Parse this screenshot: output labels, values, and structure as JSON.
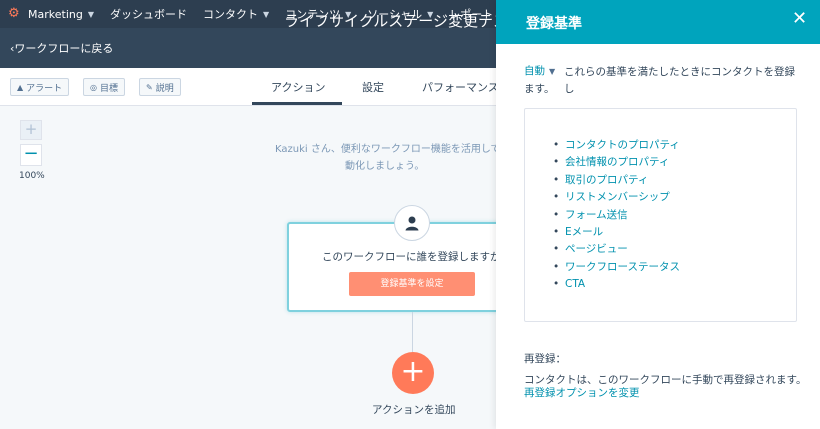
{
  "topnav": {
    "brand": "Marketing",
    "items": [
      {
        "label": "ダッシュボード"
      },
      {
        "label": "コンタクト"
      },
      {
        "label": "コンテンツ"
      },
      {
        "label": "ソーシャル"
      },
      {
        "label": "レポート"
      }
    ]
  },
  "subheader": {
    "back": "ワークフローに戻る",
    "title": "ライフサイクルステージ変更テス"
  },
  "toolbar": {
    "alert": "アラート",
    "goal": "目標",
    "description": "説明",
    "tabs": [
      "アクション",
      "設定",
      "パフォーマンス"
    ]
  },
  "canvas": {
    "zoom_level": "100%",
    "tip_line1": "Kazuki さん、便利なワークフロー機能を活用して",
    "tip_line2": "動化しましょう。",
    "trigger_question": "このワークフローに誰を登録しますか?",
    "set_criteria": "登録基準を設定",
    "add_action": "アクションを追加"
  },
  "panel": {
    "title": "登録基準",
    "auto_dropdown": "自動",
    "criteria_line1": "これらの基準を満たしたときにコンタクトを登録し",
    "criteria_line2": "ます。",
    "filters": [
      "コンタクトのプロパティ",
      "会社情報のプロパティ",
      "取引のプロパティ",
      "リストメンバーシップ",
      "フォーム送信",
      "Eメール",
      "ページビュー",
      "ワークフローステータス",
      "CTA"
    ],
    "reenroll_label": "再登録：",
    "reenroll_text": "コンタクトは、このワークフローに手動で再登録されます。",
    "reenroll_link": "再登録オプションを変更"
  }
}
